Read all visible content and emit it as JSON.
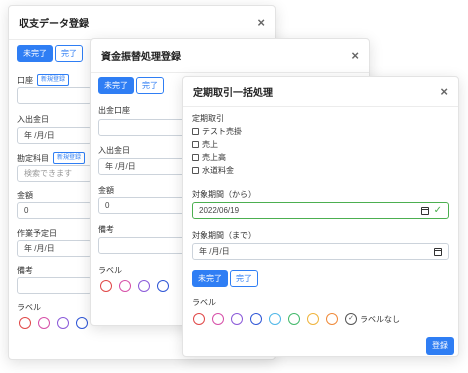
{
  "colors": {
    "primary": "#2f7ef4",
    "success": "#4caf50",
    "label_circles": [
      "#e04848",
      "#d64fa8",
      "#8b5ad9",
      "#2f56d6",
      "#4fb7e8",
      "#43b96b",
      "#efb43c",
      "#f08a3a"
    ]
  },
  "dialog1": {
    "title": "収支データ登録",
    "close": "×",
    "seg": [
      "未完了",
      "完了"
    ],
    "account_label": "口座",
    "account_new": "新規登録",
    "date_label": "入出金日",
    "date_value": "年 /月/日",
    "subject_label": "勘定科目",
    "subject_new": "新規登録",
    "subject_placeholder": "検索できます",
    "amount_label": "金額",
    "amount_value": "0",
    "work_date_label": "作業予定日",
    "work_date_value": "年 /月/日",
    "memo_label": "備考",
    "label_label": "ラベル"
  },
  "dialog2": {
    "title": "資金振替処理登録",
    "close": "×",
    "seg": [
      "未完了",
      "完了"
    ],
    "out_account_label": "出金口座",
    "date_label": "入出金日",
    "date_value": "年 /月/日",
    "amount_label": "金額",
    "amount_value": "0",
    "memo_label": "備考",
    "label_label": "ラベル"
  },
  "dialog3": {
    "title": "定期取引一括処理",
    "close": "×",
    "periodic_label": "定期取引",
    "periodic_items": [
      "テスト売掛",
      "売上",
      "売上高",
      "水道料金"
    ],
    "from_label": "対象期間（から）",
    "from_value": "2022/06/19",
    "to_label": "対象期間（まで）",
    "to_value": "年 /月/日",
    "seg": [
      "未完了",
      "完了"
    ],
    "label_label": "ラベル",
    "no_label": "ラベルなし",
    "register": "登録"
  }
}
